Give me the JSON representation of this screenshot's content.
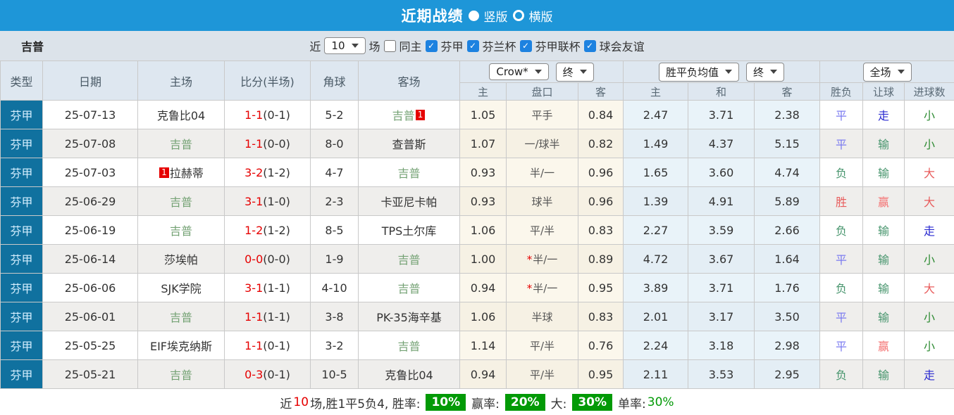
{
  "topbar": {
    "title": "近期战绩",
    "radio1": "竖版",
    "radio2": "横版"
  },
  "filter": {
    "team": "吉普",
    "near_label": "近",
    "match_count": "10",
    "field_label": "场",
    "same_home": "同主",
    "leagues": [
      "芬甲",
      "芬兰杯",
      "芬甲联杯",
      "球会友谊"
    ]
  },
  "header": {
    "cols": [
      "类型",
      "日期",
      "主场",
      "比分(半场)",
      "角球",
      "客场"
    ],
    "crow_select": "Crow*",
    "crow_state": "终",
    "avg_select": "胜平负均值",
    "avg_state": "终",
    "scope_select": "全场",
    "sub": [
      "主",
      "盘口",
      "客",
      "主",
      "和",
      "客",
      "胜负",
      "让球",
      "进球数"
    ]
  },
  "table": {
    "rows": [
      {
        "league": "芬甲",
        "date": "25-07-13",
        "home": "克鲁比04",
        "home_color": "black",
        "home_badge_before": "",
        "home_badge_after": "",
        "score": "1-1",
        "half": "(0-1)",
        "corner": "5-2",
        "away": "吉普",
        "away_color": "green",
        "away_badge_before": "",
        "away_badge_after": "1",
        "crow_home": "1.05",
        "star": "",
        "handicap": "平手",
        "crow_away": "0.84",
        "avg_home": "2.47",
        "avg_draw": "3.71",
        "avg_away": "2.38",
        "result": "平",
        "result_color": "blue",
        "let_result": "走",
        "let_color": "dblue",
        "goal": "小",
        "goal_color": "sgreen"
      },
      {
        "league": "芬甲",
        "date": "25-07-08",
        "home": "吉普",
        "home_color": "green",
        "home_badge_before": "",
        "home_badge_after": "",
        "score": "1-1",
        "half": "(0-0)",
        "corner": "8-0",
        "away": "查普斯",
        "away_color": "black",
        "away_badge_before": "",
        "away_badge_after": "",
        "crow_home": "1.07",
        "star": "",
        "handicap": "一/球半",
        "crow_away": "0.82",
        "avg_home": "1.49",
        "avg_draw": "4.37",
        "avg_away": "5.15",
        "result": "平",
        "result_color": "blue",
        "let_result": "输",
        "let_color": "rgreen",
        "goal": "小",
        "goal_color": "sgreen"
      },
      {
        "league": "芬甲",
        "date": "25-07-03",
        "home": "拉赫蒂",
        "home_color": "black",
        "home_badge_before": "1",
        "home_badge_after": "",
        "score": "3-2",
        "half": "(1-2)",
        "corner": "4-7",
        "away": "吉普",
        "away_color": "green",
        "away_badge_before": "",
        "away_badge_after": "",
        "crow_home": "0.93",
        "star": "",
        "handicap": "半/一",
        "crow_away": "0.96",
        "avg_home": "1.65",
        "avg_draw": "3.60",
        "avg_away": "4.74",
        "result": "负",
        "result_color": "rgreen",
        "let_result": "输",
        "let_color": "rgreen",
        "goal": "大",
        "goal_color": "red"
      },
      {
        "league": "芬甲",
        "date": "25-06-29",
        "home": "吉普",
        "home_color": "green",
        "home_badge_before": "",
        "home_badge_after": "",
        "score": "3-1",
        "half": "(1-0)",
        "corner": "2-3",
        "away": "卡亚尼卡帕",
        "away_color": "black",
        "away_badge_before": "",
        "away_badge_after": "",
        "crow_home": "0.93",
        "star": "",
        "handicap": "球半",
        "crow_away": "0.96",
        "avg_home": "1.39",
        "avg_draw": "4.91",
        "avg_away": "5.89",
        "result": "胜",
        "result_color": "red",
        "let_result": "赢",
        "let_color": "pink",
        "goal": "大",
        "goal_color": "red"
      },
      {
        "league": "芬甲",
        "date": "25-06-19",
        "home": "吉普",
        "home_color": "green",
        "home_badge_before": "",
        "home_badge_after": "",
        "score": "1-2",
        "half": "(1-2)",
        "corner": "8-5",
        "away": "TPS土尔库",
        "away_color": "black",
        "away_badge_before": "",
        "away_badge_after": "",
        "crow_home": "1.06",
        "star": "",
        "handicap": "平/半",
        "crow_away": "0.83",
        "avg_home": "2.27",
        "avg_draw": "3.59",
        "avg_away": "2.66",
        "result": "负",
        "result_color": "rgreen",
        "let_result": "输",
        "let_color": "rgreen",
        "goal": "走",
        "goal_color": "dblue"
      },
      {
        "league": "芬甲",
        "date": "25-06-14",
        "home": "莎埃帕",
        "home_color": "black",
        "home_badge_before": "",
        "home_badge_after": "",
        "score": "0-0",
        "half": "(0-0)",
        "corner": "1-9",
        "away": "吉普",
        "away_color": "green",
        "away_badge_before": "",
        "away_badge_after": "",
        "crow_home": "1.00",
        "star": "*",
        "handicap": "半/一",
        "crow_away": "0.89",
        "avg_home": "4.72",
        "avg_draw": "3.67",
        "avg_away": "1.64",
        "result": "平",
        "result_color": "blue",
        "let_result": "输",
        "let_color": "rgreen",
        "goal": "小",
        "goal_color": "sgreen"
      },
      {
        "league": "芬甲",
        "date": "25-06-06",
        "home": "SJK学院",
        "home_color": "black",
        "home_badge_before": "",
        "home_badge_after": "",
        "score": "3-1",
        "half": "(1-1)",
        "corner": "4-10",
        "away": "吉普",
        "away_color": "green",
        "away_badge_before": "",
        "away_badge_after": "",
        "crow_home": "0.94",
        "star": "*",
        "handicap": "半/一",
        "crow_away": "0.95",
        "avg_home": "3.89",
        "avg_draw": "3.71",
        "avg_away": "1.76",
        "result": "负",
        "result_color": "rgreen",
        "let_result": "输",
        "let_color": "rgreen",
        "goal": "大",
        "goal_color": "red"
      },
      {
        "league": "芬甲",
        "date": "25-06-01",
        "home": "吉普",
        "home_color": "green",
        "home_badge_before": "",
        "home_badge_after": "",
        "score": "1-1",
        "half": "(1-1)",
        "corner": "3-8",
        "away": "PK-35海辛基",
        "away_color": "black",
        "away_badge_before": "",
        "away_badge_after": "",
        "crow_home": "1.06",
        "star": "",
        "handicap": "半球",
        "crow_away": "0.83",
        "avg_home": "2.01",
        "avg_draw": "3.17",
        "avg_away": "3.50",
        "result": "平",
        "result_color": "blue",
        "let_result": "输",
        "let_color": "rgreen",
        "goal": "小",
        "goal_color": "sgreen"
      },
      {
        "league": "芬甲",
        "date": "25-05-25",
        "home": "EIF埃克纳斯",
        "home_color": "black",
        "home_badge_before": "",
        "home_badge_after": "",
        "score": "1-1",
        "half": "(0-1)",
        "corner": "3-2",
        "away": "吉普",
        "away_color": "green",
        "away_badge_before": "",
        "away_badge_after": "",
        "crow_home": "1.14",
        "star": "",
        "handicap": "平/半",
        "crow_away": "0.76",
        "avg_home": "2.24",
        "avg_draw": "3.18",
        "avg_away": "2.98",
        "result": "平",
        "result_color": "blue",
        "let_result": "赢",
        "let_color": "pink",
        "goal": "小",
        "goal_color": "sgreen"
      },
      {
        "league": "芬甲",
        "date": "25-05-21",
        "home": "吉普",
        "home_color": "green",
        "home_badge_before": "",
        "home_badge_after": "",
        "score": "0-3",
        "half": "(0-1)",
        "corner": "10-5",
        "away": "克鲁比04",
        "away_color": "black",
        "away_badge_before": "",
        "away_badge_after": "",
        "crow_home": "0.94",
        "star": "",
        "handicap": "平/半",
        "crow_away": "0.95",
        "avg_home": "2.11",
        "avg_draw": "3.53",
        "avg_away": "2.95",
        "result": "负",
        "result_color": "rgreen",
        "let_result": "输",
        "let_color": "rgreen",
        "goal": "走",
        "goal_color": "dblue"
      }
    ]
  },
  "summary": {
    "near_label": "近",
    "count": "10",
    "record": "场,胜1平5负4, 胜率:",
    "rate1": "10%",
    "label2": "赢率:",
    "rate2": "20%",
    "label3": "大:",
    "rate3": "30%",
    "label4": "单率:",
    "rate4": "30%"
  }
}
